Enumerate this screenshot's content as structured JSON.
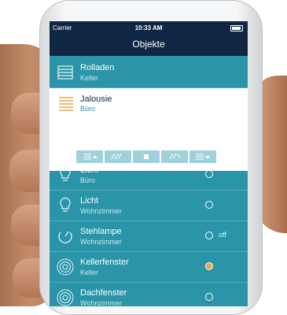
{
  "statusbar": {
    "carrier": "Carrier",
    "time": "10:33 AM"
  },
  "nav": {
    "title": "Objekte"
  },
  "items": [
    {
      "title": "Rolladen",
      "subtitle": "Keller",
      "icon": "shutter-icon"
    },
    {
      "title": "Jalousie",
      "subtitle": "Büro",
      "icon": "blinds-icon",
      "expanded": true
    },
    {
      "title": "Licht",
      "subtitle": "Büro",
      "icon": "bulb-icon",
      "state": "off"
    },
    {
      "title": "Licht",
      "subtitle": "Wohnzimmer",
      "icon": "bulb-icon",
      "state": "off"
    },
    {
      "title": "Stehlampe",
      "subtitle": "Wohnzimmer",
      "icon": "dimmer-icon",
      "state": "off",
      "state_label": "off"
    },
    {
      "title": "Kellerfenster",
      "subtitle": "Keller",
      "icon": "window-icon",
      "state": "on"
    },
    {
      "title": "Dachfenster",
      "subtitle": "Wohnzimmer",
      "icon": "window-icon",
      "state": "off"
    }
  ],
  "controls": [
    "blinds-up-icon",
    "tilt-open-icon",
    "stop-icon",
    "tilt-close-icon",
    "blinds-down-icon"
  ],
  "colors": {
    "navbar": "#0f2744",
    "list": "#2a94a8",
    "accent": "#f5a04a",
    "control": "#9fd1db"
  }
}
